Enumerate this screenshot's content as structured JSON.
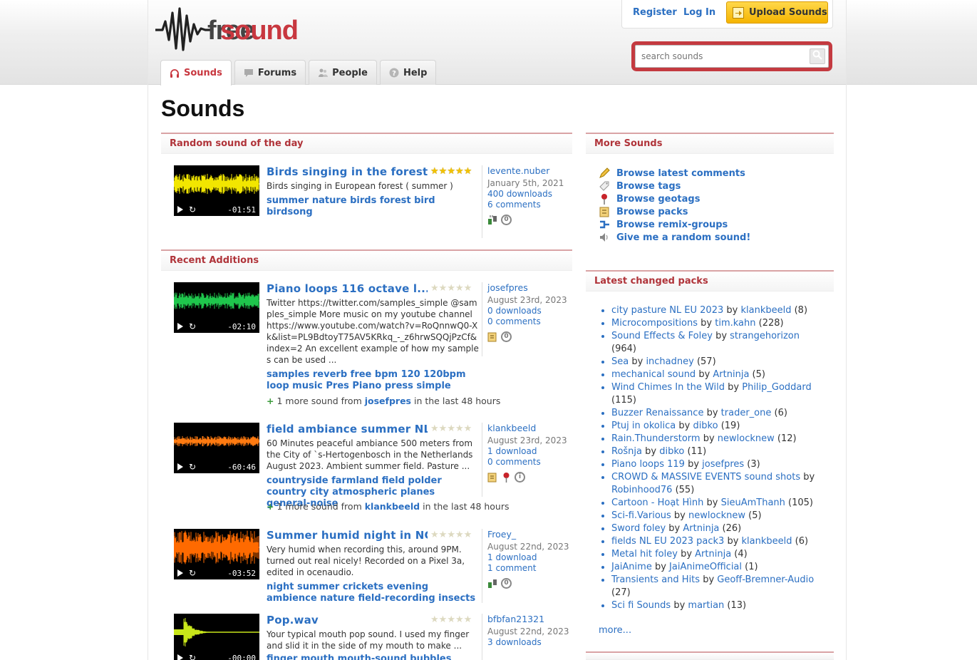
{
  "header": {
    "logo": {
      "text_free": "free",
      "text_sound": "sound"
    },
    "account": {
      "register": "Register",
      "login": "Log In",
      "upload": "Upload Sounds"
    },
    "search": {
      "placeholder": "search sounds"
    },
    "tabs": [
      {
        "label": "Sounds",
        "icon": "headphones-icon",
        "active": true
      },
      {
        "label": "Forums",
        "icon": "speech-bubble-icon",
        "active": false
      },
      {
        "label": "People",
        "icon": "people-icon",
        "active": false
      },
      {
        "label": "Help",
        "icon": "help-icon",
        "active": false
      }
    ]
  },
  "main": {
    "title": "Sounds",
    "random_section": {
      "title": "Random sound of the day"
    },
    "recent_section": {
      "title": "Recent Additions"
    },
    "random_sound": {
      "title": "Birds singing in the forest",
      "rating": 5,
      "description": "Birds singing in European forest ( summer )",
      "tags": "summer nature birds forest bird birdsong",
      "duration": "-01:51",
      "wave_color": "#f2e600",
      "user": "levente.nuber",
      "date": "January 5th, 2021",
      "downloads": "400 downloads",
      "comments": "6 comments"
    },
    "recent": [
      {
        "title": "Piano loops 116 octave l...",
        "rating": 0,
        "description": "Twitter https://twitter.com/samples_simple @samples_simple More music on my youtube channel https://www.youtube.com/watch?v=RoQnnwQ0-Xk&list=PL9BdtoyT75AV5KRkq_-_z6hrwSQQjPzCf&index=2 An excellent example of how my samples can be used ...",
        "tags": "samples reverb free bpm 120 120bpm loop music Pres Piano press simple",
        "duration": "-02:10",
        "wave_color": "#1fc64c",
        "user": "josefpres",
        "date": "August 23rd, 2023",
        "downloads": "0 downloads",
        "comments": "0 comments",
        "more_prefix": "1 more sound from",
        "more_user": "josefpres",
        "more_suffix": "in the last 48 hours"
      },
      {
        "title": "field ambiance summer NL...",
        "rating": 0,
        "description": "60 Minutes peaceful ambiance 500 meters from the City of `s-Hertogenbosch in the Netherlands August 2023. Ambient summer field. Pasture ...",
        "tags": "countryside farmland field polder country city atmospheric planes general-noise",
        "duration": "-60:46",
        "wave_color": "#ff7a10",
        "user": "klankbeeld",
        "date": "August 23rd, 2023",
        "downloads": "1 download",
        "comments": "0 comments",
        "more_prefix": "1 more sound from",
        "more_user": "klankbeeld",
        "more_suffix": "in the last 48 hours"
      },
      {
        "title": "Summer humid night in NC",
        "rating": 0,
        "description": "Very humid when recording this, around 9PM. turned out real nicely! Recorded on a Pixel 3a, edited in ocenaudio.",
        "tags": "night summer crickets evening ambience nature field-recording insects",
        "duration": "-03:52",
        "wave_color": "#ff6a00",
        "user": "Froey_",
        "date": "August 22nd, 2023",
        "downloads": "1 download",
        "comments": "1 comment"
      },
      {
        "title": "Pop.wav",
        "rating": 0,
        "description": "Your typical mouth pop sound. I used my finger and slid it in the side of my mouth to make ...",
        "tags": "finger mouth mouth-sound bubbles",
        "duration": "-00:00",
        "wave_color": "#c8e61a",
        "user": "bfbfan21321",
        "date": "August 22nd, 2023",
        "downloads": "3 downloads",
        "comments": ""
      }
    ]
  },
  "sidebar": {
    "more_sounds": {
      "title": "More Sounds",
      "items": [
        {
          "label": "Browse latest comments",
          "icon": "pencil-icon"
        },
        {
          "label": "Browse tags",
          "icon": "tag-icon"
        },
        {
          "label": "Browse geotags",
          "icon": "map-pin-icon"
        },
        {
          "label": "Browse packs",
          "icon": "pack-icon"
        },
        {
          "label": "Browse remix-groups",
          "icon": "remix-icon"
        },
        {
          "label": "Give me a random sound!",
          "icon": "speaker-icon"
        }
      ]
    },
    "latest_packs": {
      "title": "Latest changed packs",
      "by": "by",
      "items": [
        {
          "name": "city pasture NL EU 2023",
          "user": "klankbeeld",
          "count": "(8)"
        },
        {
          "name": "Microcompositions",
          "user": "tim.kahn",
          "count": "(228)"
        },
        {
          "name": "Sound Effects & Foley",
          "user": "strangehorizon",
          "count": "(964)"
        },
        {
          "name": "Sea",
          "user": "inchadney",
          "count": "(57)"
        },
        {
          "name": "mechanical sound",
          "user": "Artninja",
          "count": "(5)"
        },
        {
          "name": "Wind Chimes In the Wild",
          "user": "Philip_Goddard",
          "count": "(115)"
        },
        {
          "name": "Buzzer Renaissance",
          "user": "trader_one",
          "count": "(6)"
        },
        {
          "name": "Ptuj in okolica",
          "user": "dibko",
          "count": "(19)"
        },
        {
          "name": "Rain.Thunderstorm",
          "user": "newlocknew",
          "count": "(12)"
        },
        {
          "name": "Rošnja",
          "user": "dibko",
          "count": "(11)"
        },
        {
          "name": "Piano loops 119",
          "user": "josefpres",
          "count": "(3)"
        },
        {
          "name": "CROWD & MASSIVE EVENTS sound shots",
          "user": "Robinhood76",
          "count": "(55)"
        },
        {
          "name": "Cartoon - Hoạt Hình",
          "user": "SieuAmThanh",
          "count": "(105)"
        },
        {
          "name": "Sci-fi.Various",
          "user": "newlocknew",
          "count": "(5)"
        },
        {
          "name": "Sword foley",
          "user": "Artninja",
          "count": "(26)"
        },
        {
          "name": "fields NL EU 2023 pack3",
          "user": "klankbeeld",
          "count": "(6)"
        },
        {
          "name": "Metal hit foley",
          "user": "Artninja",
          "count": "(4)"
        },
        {
          "name": "JaiAnime",
          "user": "JaiAnimeOfficial",
          "count": "(1)"
        },
        {
          "name": "Transients and Hits",
          "user": "Geoff-Bremner-Audio",
          "count": "(27)"
        },
        {
          "name": "Sci fi Sounds",
          "user": "martian",
          "count": "(13)"
        }
      ],
      "more": "more..."
    }
  }
}
